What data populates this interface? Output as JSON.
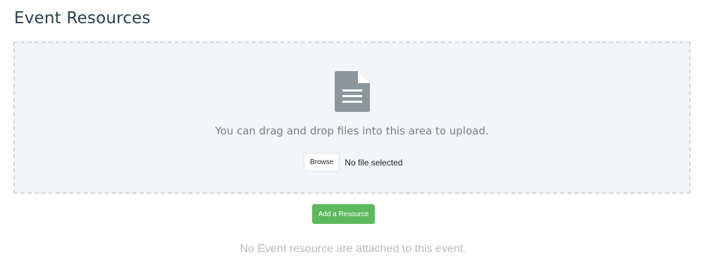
{
  "page": {
    "title": "Event Resources"
  },
  "dropzone": {
    "icon": "file-text-icon",
    "instruction": "You can drag and drop files into this area to upload.",
    "browse_label": "Browse",
    "file_status": "No file selected"
  },
  "actions": {
    "add_resource_label": "Add a Resource"
  },
  "resources": {
    "empty_message": "No Event resource are attached to this event."
  },
  "colors": {
    "title": "#2b3d4f",
    "dropzone_bg": "#f3f6f9",
    "dropzone_border": "#d3d6da",
    "icon": "#8e969d",
    "add_button": "#5cb85c",
    "muted_text": "#b6b9bd"
  }
}
